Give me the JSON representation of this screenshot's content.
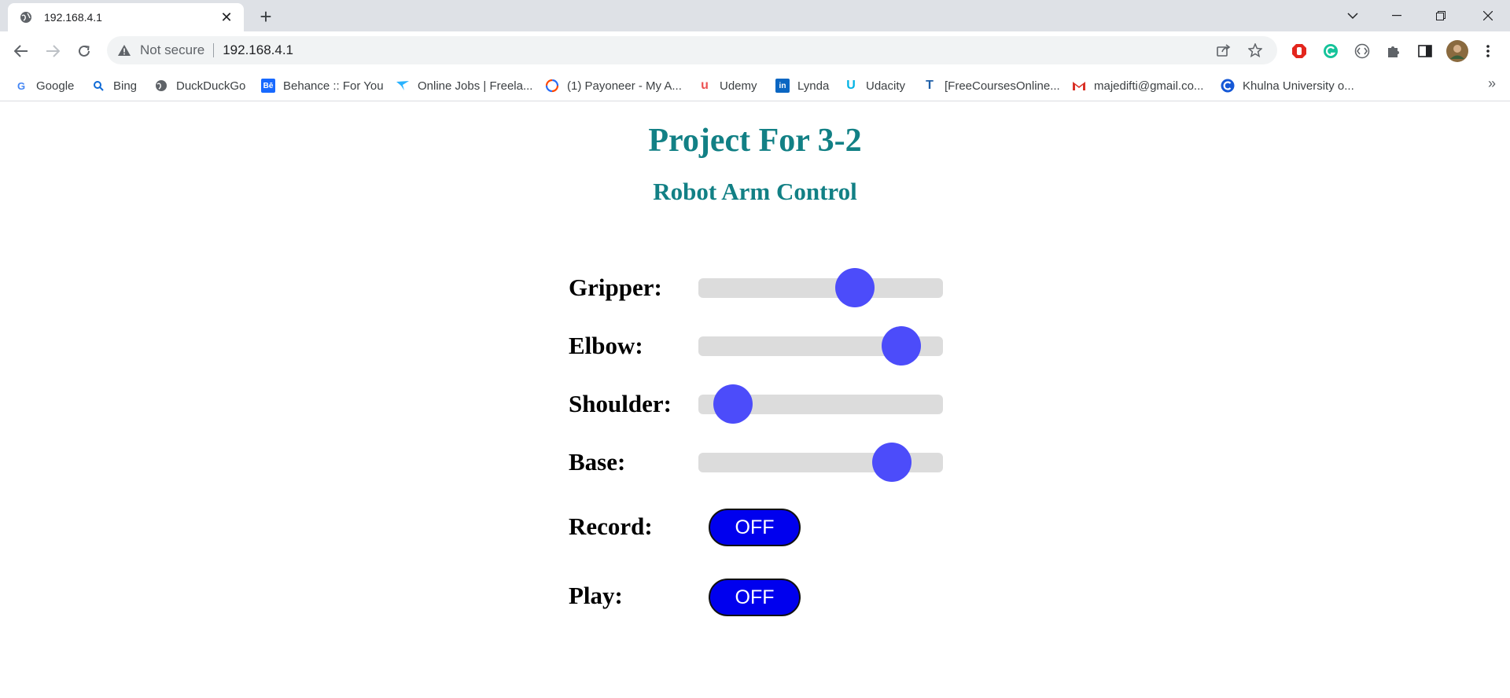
{
  "browser": {
    "tab_title": "192.168.4.1",
    "tab_close": "✕",
    "new_tab": "+",
    "security_label": "Not secure",
    "url": "192.168.4.1",
    "bookmarks": [
      {
        "label": "Google",
        "icon": "google-icon",
        "glyph": "G",
        "color": "#4285f4"
      },
      {
        "label": "Bing",
        "icon": "bing-search-icon",
        "glyph": "⚲",
        "color": "#0f6ad6"
      },
      {
        "label": "DuckDuckGo",
        "icon": "globe-icon",
        "glyph": "◍",
        "color": "#5f6368"
      },
      {
        "label": "Behance :: For You",
        "icon": "behance-icon",
        "glyph": "Bē",
        "color": "#1769ff"
      },
      {
        "label": "Online Jobs | Freela...",
        "icon": "freelancer-bird-icon",
        "glyph": "✈",
        "color": "#29b2fe"
      },
      {
        "label": "(1) Payoneer - My A...",
        "icon": "payoneer-ring-icon",
        "glyph": "◯",
        "color": "#ff4800"
      },
      {
        "label": "Udemy",
        "icon": "udemy-icon",
        "glyph": "u",
        "color": "#ec5252"
      },
      {
        "label": "Lynda",
        "icon": "linkedin-icon",
        "glyph": "in",
        "color": "#0a66c2"
      },
      {
        "label": "Udacity",
        "icon": "udacity-icon",
        "glyph": "U",
        "color": "#02b3e4"
      },
      {
        "label": "[FreeCoursesOnline...",
        "icon": "freecourses-icon",
        "glyph": "T",
        "color": "#1f5fa8"
      },
      {
        "label": "majedifti@gmail.co...",
        "icon": "gmail-icon",
        "glyph": "M",
        "color": "#d93025"
      },
      {
        "label": "Khulna University o...",
        "icon": "khulna-university-icon",
        "glyph": "C",
        "color": "#1558d6"
      }
    ],
    "more_bookmarks": "»"
  },
  "page": {
    "title": "Project For 3-2",
    "subtitle": "Robot Arm Control",
    "sliders": [
      {
        "label": "Gripper:",
        "value": 0.64
      },
      {
        "label": "Elbow:",
        "value": 0.83
      },
      {
        "label": "Shoulder:",
        "value": 0.14
      },
      {
        "label": "Base:",
        "value": 0.79
      }
    ],
    "toggles": [
      {
        "label": "Record:",
        "state": "OFF"
      },
      {
        "label": "Play:",
        "state": "OFF"
      }
    ],
    "colors": {
      "heading": "#128085",
      "slider_thumb": "#4c4cfa",
      "toggle_bg": "#0000ee"
    }
  }
}
